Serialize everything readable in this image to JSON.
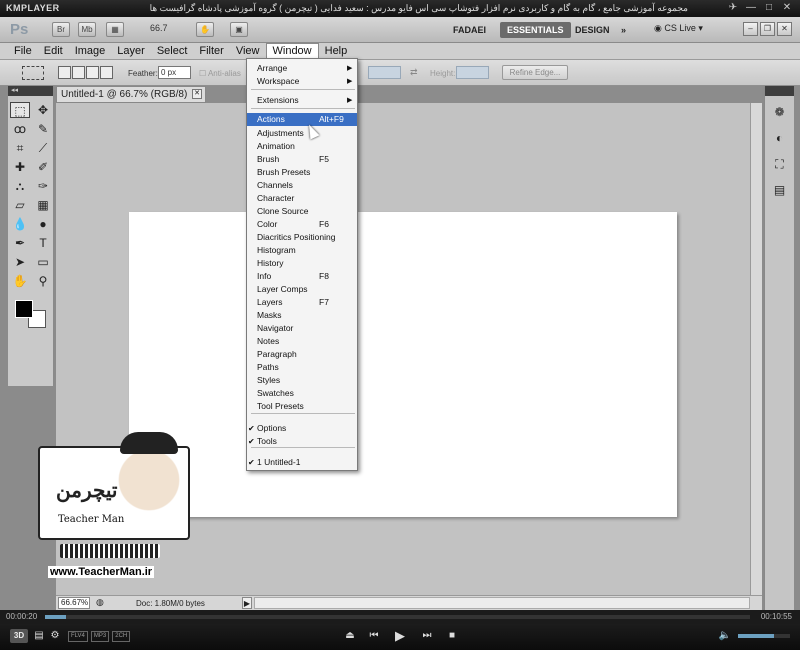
{
  "kmplayer": {
    "logo": "KMPLAYER",
    "caption": "مجموعه آموزشی جامع ، گام به گام و کاربردی نرم افزار فتوشاپ سی اس فایو مدرس : سعید فدایی ( تیچرمن ) گروه آموزشی پادشاه گرافیست ها",
    "time_elapsed": "00:00:20",
    "time_total": "00:10:55",
    "progress": 0.03,
    "volume": 0.7,
    "badge_3d": "3D",
    "badges": [
      "FLV4",
      "MP3",
      "2CH"
    ]
  },
  "photoshop": {
    "logo": "Ps",
    "app_buttons": [
      "Br",
      "Mb"
    ],
    "zoom_level": "66.7",
    "workspaces": [
      "FADAEI",
      "ESSENTIALS",
      "DESIGN"
    ],
    "active_workspace": "ESSENTIALS",
    "cs_live": "CS Live",
    "menus": [
      "File",
      "Edit",
      "Image",
      "Layer",
      "Select",
      "Filter",
      "View",
      "Window",
      "Help"
    ],
    "open_menu": "Window",
    "options": {
      "feather_label": "Feather:",
      "feather_value": "0 px",
      "antialias_label": "Anti-alias",
      "height_label": "Height:",
      "refine_edge": "Refine Edge..."
    },
    "document": {
      "tab_title": "Untitled-1 @ 66.7% (RGB/8)",
      "status_zoom": "66.67%",
      "doc_info": "Doc: 1.80M/0 bytes"
    }
  },
  "window_menu": {
    "items": [
      {
        "label": "Arrange",
        "shortcut": "",
        "submenu": true,
        "check": false
      },
      {
        "label": "Workspace",
        "shortcut": "",
        "submenu": true,
        "check": false
      },
      {
        "label": "Extensions",
        "shortcut": "",
        "submenu": true,
        "check": false
      },
      {
        "label": "Actions",
        "shortcut": "Alt+F9",
        "submenu": false,
        "check": false,
        "highlighted": true
      },
      {
        "label": "Adjustments",
        "shortcut": "",
        "submenu": false,
        "check": false
      },
      {
        "label": "Animation",
        "shortcut": "",
        "submenu": false,
        "check": false
      },
      {
        "label": "Brush",
        "shortcut": "F5",
        "submenu": false,
        "check": false
      },
      {
        "label": "Brush Presets",
        "shortcut": "",
        "submenu": false,
        "check": false
      },
      {
        "label": "Channels",
        "shortcut": "",
        "submenu": false,
        "check": false
      },
      {
        "label": "Character",
        "shortcut": "",
        "submenu": false,
        "check": false
      },
      {
        "label": "Clone Source",
        "shortcut": "",
        "submenu": false,
        "check": false
      },
      {
        "label": "Color",
        "shortcut": "F6",
        "submenu": false,
        "check": false
      },
      {
        "label": "Diacritics Positioning",
        "shortcut": "",
        "submenu": false,
        "check": false
      },
      {
        "label": "Histogram",
        "shortcut": "",
        "submenu": false,
        "check": false
      },
      {
        "label": "History",
        "shortcut": "",
        "submenu": false,
        "check": false
      },
      {
        "label": "Info",
        "shortcut": "F8",
        "submenu": false,
        "check": false
      },
      {
        "label": "Layer Comps",
        "shortcut": "",
        "submenu": false,
        "check": false
      },
      {
        "label": "Layers",
        "shortcut": "F7",
        "submenu": false,
        "check": false
      },
      {
        "label": "Masks",
        "shortcut": "",
        "submenu": false,
        "check": false
      },
      {
        "label": "Navigator",
        "shortcut": "",
        "submenu": false,
        "check": false
      },
      {
        "label": "Notes",
        "shortcut": "",
        "submenu": false,
        "check": false
      },
      {
        "label": "Paragraph",
        "shortcut": "",
        "submenu": false,
        "check": false
      },
      {
        "label": "Paths",
        "shortcut": "",
        "submenu": false,
        "check": false
      },
      {
        "label": "Styles",
        "shortcut": "",
        "submenu": false,
        "check": false
      },
      {
        "label": "Swatches",
        "shortcut": "",
        "submenu": false,
        "check": false
      },
      {
        "label": "Tool Presets",
        "shortcut": "",
        "submenu": false,
        "check": false
      },
      {
        "label": "Options",
        "shortcut": "",
        "submenu": false,
        "check": true
      },
      {
        "label": "Tools",
        "shortcut": "",
        "submenu": false,
        "check": true
      },
      {
        "label": "1 Untitled-1",
        "shortcut": "",
        "submenu": false,
        "check": true
      }
    ]
  },
  "watermark": {
    "logo_fa": "تیچرمن",
    "logo_en": "Teacher Man",
    "url": "www.TeacherMan.ir"
  },
  "colors": {
    "menu_highlight": "#3a6fc4",
    "workspace_bg": "#c2c2c2",
    "accent": "#6ca0c0"
  }
}
